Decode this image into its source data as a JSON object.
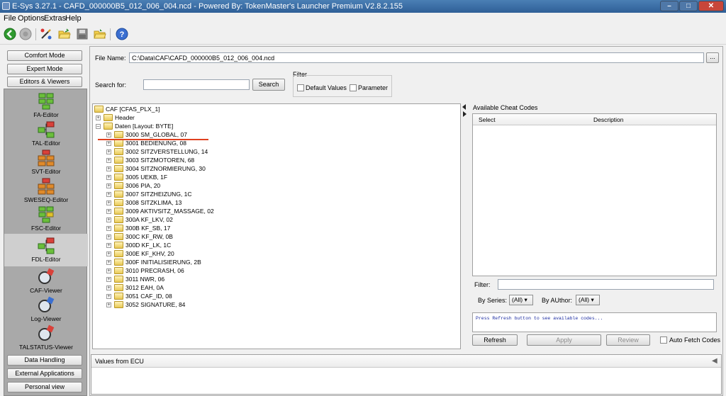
{
  "window": {
    "title": "E-Sys 3.27.1 - CAFD_000000B5_012_006_004.ncd  - Powered By: TokenMaster's Launcher Premium V2.8.2.155",
    "controls": [
      "minimize",
      "maximize",
      "close"
    ]
  },
  "menu": [
    "File",
    "Options",
    "Extras",
    "Help"
  ],
  "toolbar": {
    "icons": [
      "back-icon",
      "disabled-circle-icon",
      "connect-icon",
      "open-folder-icon",
      "save-icon",
      "open-file-icon",
      "help-icon"
    ]
  },
  "sidebar": {
    "top_buttons": [
      "Comfort Mode",
      "Expert Mode",
      "Editors & Viewers"
    ],
    "editors": [
      "FA-Editor",
      "TAL-Editor",
      "SVT-Editor",
      "SWESEQ-Editor",
      "FSC-Editor",
      "FDL-Editor",
      "CAF-Viewer",
      "Log-Viewer",
      "TALSTATUS-Viewer"
    ],
    "bottom_buttons": [
      "Data Handling",
      "External Applications",
      "Personal view"
    ]
  },
  "file": {
    "label": "File Name:",
    "value": "C:\\Data\\CAF\\CAFD_000000B5_012_006_004.ncd",
    "browse_label": "..."
  },
  "search": {
    "label": "Search for:",
    "value": "",
    "button": "Search"
  },
  "filter": {
    "label": "Filter",
    "default_values": "Default Values",
    "parameter": "Parameter"
  },
  "tree": {
    "root": "CAF [CFAS_PLX_1]",
    "header": "Header",
    "daten": "Daten [Layout: BYTE]",
    "items": [
      "3000 SM_GLOBAL, 07",
      "3001 BEDIENUNG, 08",
      "3002 SITZVERSTELLUNG, 14",
      "3003 SITZMOTOREN, 68",
      "3004 SITZNORMIERUNG, 30",
      "3005 UEKB, 1F",
      "3006 PIA, 20",
      "3007 SITZHEIZUNG, 1C",
      "3008 SITZKLIMA, 13",
      "3009 AKTIVSITZ_MASSAGE, 02",
      "300A KF_LKV, 02",
      "300B KF_SB, 17",
      "300C KF_RW, 0B",
      "300D KF_LK, 1C",
      "300E KF_KHV, 20",
      "300F INITIALISIERUNG, 2B",
      "3010 PRECRASH, 06",
      "3011 NWR, 06",
      "3012 EAH, 0A",
      "3051 CAF_ID, 08",
      "3052 SIGNATURE, 84"
    ]
  },
  "cheat": {
    "title": "Available Cheat Codes",
    "col_select": "Select",
    "col_description": "Description",
    "filter_label": "Filter:",
    "by_series_label": "By Series:",
    "by_series_value": "(All)",
    "by_author_label": "By AUthor:",
    "by_author_value": "(All)",
    "message": "Press Refresh button to see available codes...",
    "refresh": "Refresh",
    "apply": "Apply",
    "review": "Review",
    "auto_fetch": "Auto Fetch Codes"
  },
  "values_panel": {
    "title": "Values from ECU"
  },
  "colors": {
    "titlebar": "#2f5f97",
    "sidebar_bg": "#a9a9a9",
    "highlight_underline": "#e0401f",
    "message_text": "#1a2aa0"
  }
}
